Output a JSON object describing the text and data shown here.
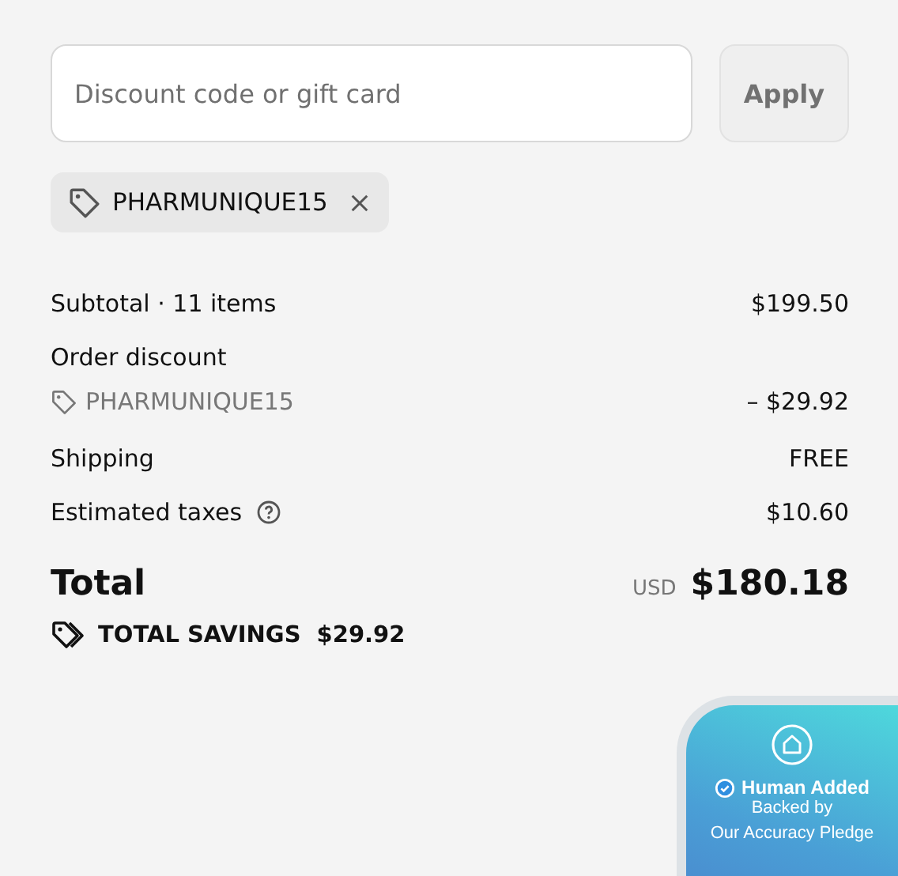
{
  "discount": {
    "placeholder": "Discount code or gift card",
    "apply": "Apply"
  },
  "applied_codes": [
    {
      "code": "PHARMUNIQUE15"
    }
  ],
  "summary": [
    {
      "kind": "line",
      "label": "Subtotal · 11 items",
      "value": "$199.50"
    },
    {
      "kind": "discount",
      "label": "Order discount",
      "code": "PHARMUNIQUE15",
      "value": "– $29.92"
    },
    {
      "kind": "line",
      "label": "Shipping",
      "value": "FREE"
    },
    {
      "kind": "info",
      "label": "Estimated taxes",
      "value": "$10.60"
    }
  ],
  "total": {
    "label": "Total",
    "currency": "USD",
    "amount": "$180.18"
  },
  "savings": {
    "label": "TOTAL SAVINGS",
    "amount": "$29.92"
  },
  "badge": {
    "title": "Human Added",
    "lines": [
      "Backed by",
      "Our Accuracy Pledge"
    ]
  }
}
